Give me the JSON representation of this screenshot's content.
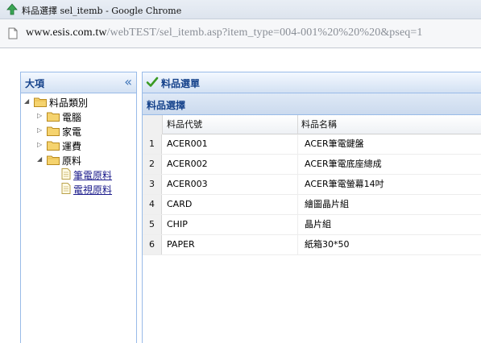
{
  "window": {
    "title": "料品選擇 sel_itemb - Google Chrome",
    "url_host": "www.esis.com.tw",
    "url_path": "/webTEST/sel_itemb.asp?item_type=004-001%20%20%20&pseq=1"
  },
  "left_panel": {
    "title": "大項",
    "tree": {
      "root": "料品類別",
      "children": [
        "電腦",
        "家電",
        "運費",
        "原料"
      ],
      "leaves": [
        "筆電原料",
        "電視原料"
      ]
    }
  },
  "right_panel": {
    "title": "料品選單",
    "grid_title": "料品選擇",
    "columns": [
      "料品代號",
      "料品名稱"
    ],
    "rows": [
      {
        "num": "1",
        "code": "ACER001",
        "name": "ACER筆電鍵盤"
      },
      {
        "num": "2",
        "code": "ACER002",
        "name": "ACER筆電底座總成"
      },
      {
        "num": "3",
        "code": "ACER003",
        "name": "ACER筆電螢幕14吋"
      },
      {
        "num": "4",
        "code": "CARD",
        "name": "繪圖晶片組"
      },
      {
        "num": "5",
        "code": "CHIP",
        "name": "晶片組"
      },
      {
        "num": "6",
        "code": "PAPER",
        "name": "紙箱30*50"
      }
    ]
  },
  "colors": {
    "panel_border": "#99bbe8",
    "panel_title": "#15428b",
    "check": "#3a9a22",
    "folder": "#f1c55b"
  },
  "icons": {
    "app": "chrome-app-icon",
    "page": "page-icon",
    "collapse": "double-chevron-left-icon",
    "check": "checkmark-icon",
    "folder": "folder-icon",
    "doc": "document-icon"
  }
}
